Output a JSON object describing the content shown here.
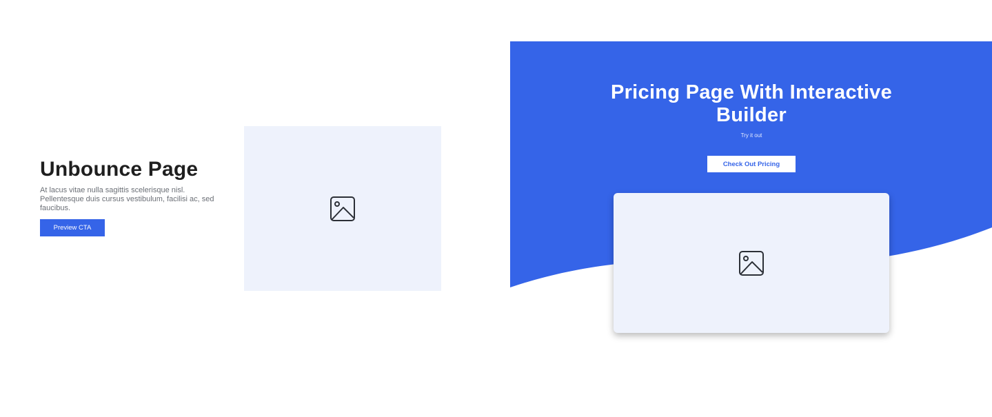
{
  "left": {
    "title": "Unbounce Page",
    "description": "At lacus vitae nulla sagittis scelerisque nisl. Pellentesque duis cursus vestibulum, facilisi ac, sed faucibus.",
    "cta_label": "Preview CTA",
    "image_icon": "image-icon"
  },
  "right": {
    "title": "Pricing Page With Interactive Builder",
    "subtitle": "Try it out",
    "cta_label": "Check Out Pricing",
    "image_icon": "image-icon"
  },
  "colors": {
    "accent": "#3564e8",
    "placeholder_bg": "#eef2fc",
    "heading": "#1f1f1f",
    "body_text": "#6b6f76"
  }
}
